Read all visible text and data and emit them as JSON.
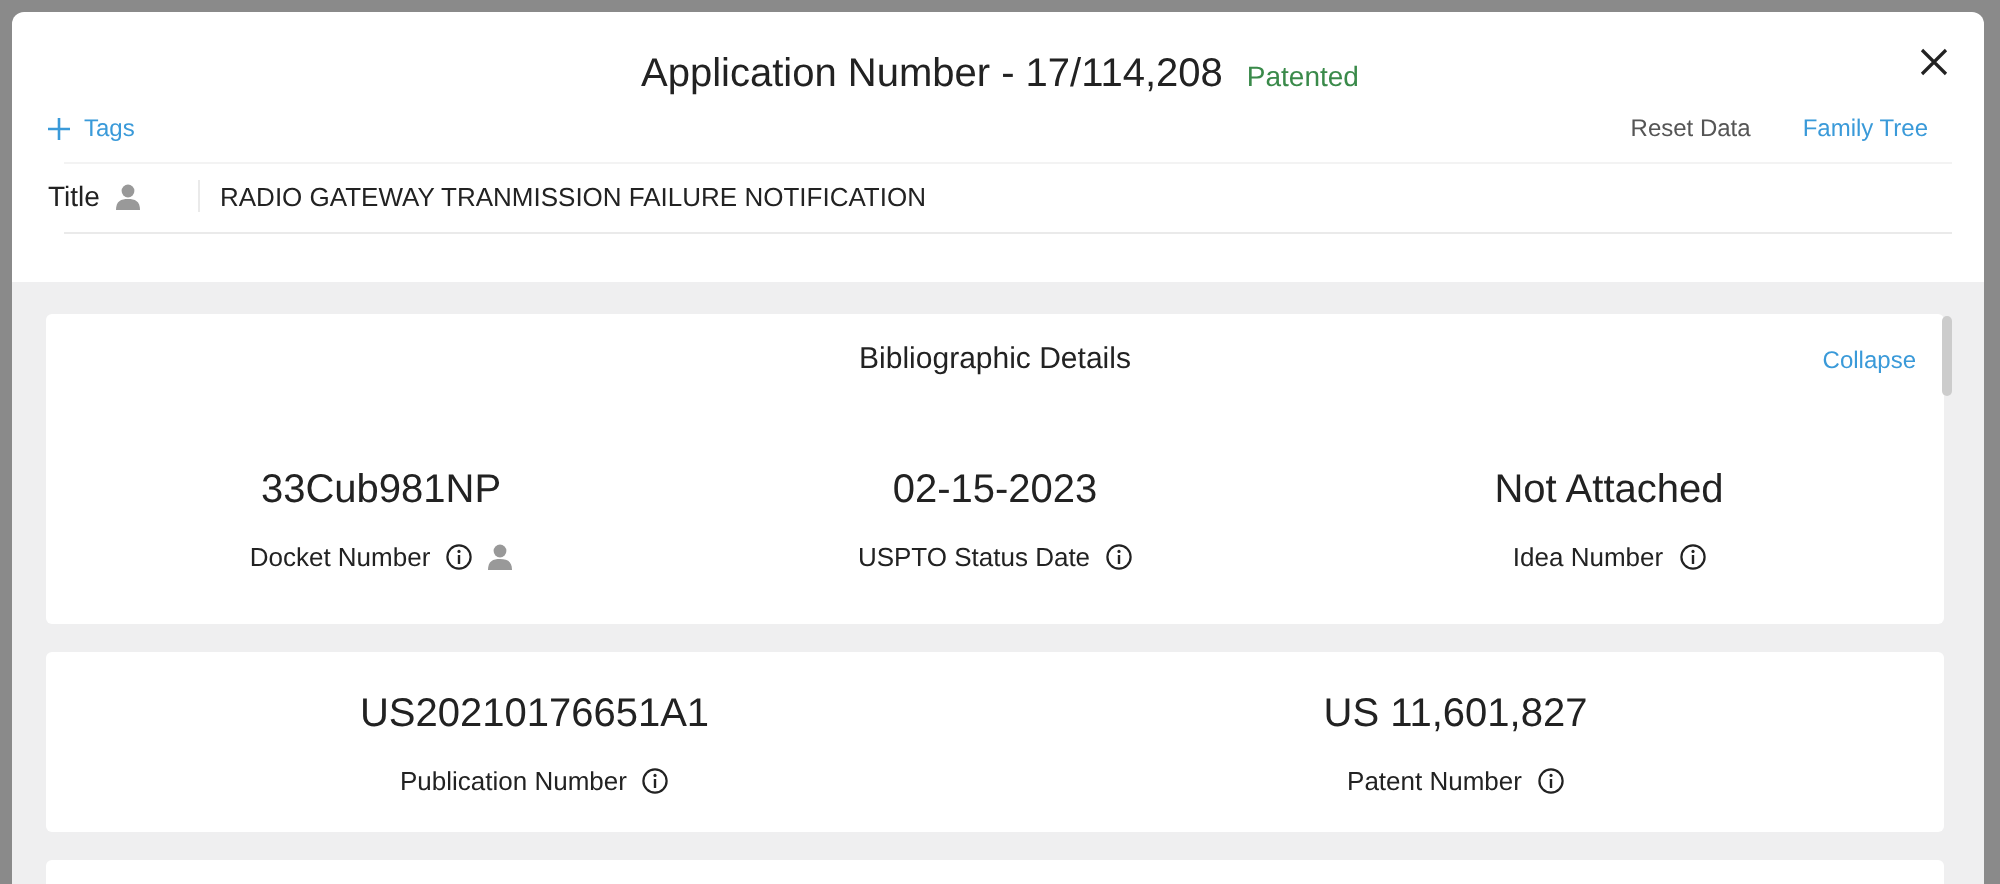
{
  "dialog": {
    "title": "Application Number - 17/114,208",
    "status": "Patented",
    "tags_link": "Tags",
    "actions": [
      {
        "label": "Reset Data",
        "kind": "plain"
      },
      {
        "label": "Family Tree",
        "kind": "link"
      }
    ],
    "title_field": {
      "label": "Title",
      "person": true,
      "value": "RADIO GATEWAY TRANMISSION FAILURE NOTIFICATION"
    }
  },
  "sections": [
    {
      "heading": "Bibliographic Details",
      "toggle": "Collapse",
      "fields": [
        {
          "value": "33Cub981NP",
          "label": "Docket Number",
          "person": true
        },
        {
          "value": "02-15-2023",
          "label": "USPTO Status Date",
          "person": false
        },
        {
          "value": "Not Attached",
          "label": "Idea Number",
          "person": false
        }
      ]
    },
    {
      "fields": [
        {
          "value": "US20210176651A1",
          "label": "Publication Number",
          "person": false
        },
        {
          "value": "US 11,601,827",
          "label": "Patent Number",
          "person": false
        }
      ]
    }
  ]
}
